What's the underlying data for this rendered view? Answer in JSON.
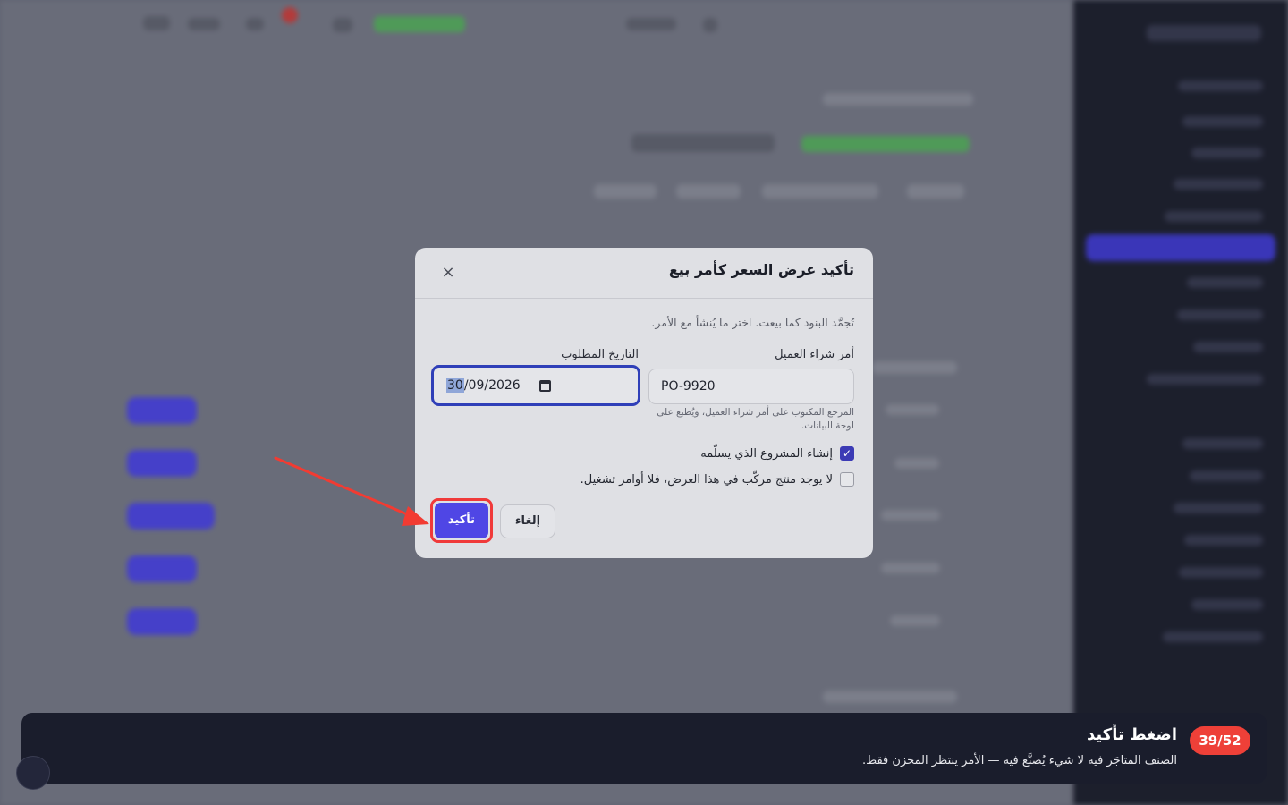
{
  "modal": {
    "title": "تأكيد عرض السعر كأمر بيع",
    "close_label": "×",
    "description": "تُجمَّد البنود كما بيعت. اختر ما يُنشأ مع الأمر.",
    "po_label": "أمر شراء العميل",
    "po_value": "PO-9920",
    "po_hint": "المرجع المكتوب على أمر شراء العميل، ويُطبع على لوحة البيانات.",
    "date_label": "التاريخ المطلوب",
    "date_day": "30",
    "date_rest": "/09/2026",
    "create_project_label": "إنشاء المشروع الذي يسلّمه",
    "create_project_checked": true,
    "no_assembly_label": "لا يوجد منتج مركّب في هذا العرض، فلا أوامر تشغيل.",
    "no_assembly_checked": false,
    "cancel_label": "إلغاء",
    "confirm_label": "تأكيد"
  },
  "tour": {
    "step": "39/52",
    "title": "اضغط تأكيد",
    "text": "الصنف المتاجَر فيه لا شيء يُصنَّع فيه — الأمر ينتظر المخزن فقط."
  },
  "colors": {
    "accent": "#4f46e5",
    "highlight": "#f03a3a",
    "tour_bg": "#1a1d2c",
    "badge": "#ee4038"
  }
}
